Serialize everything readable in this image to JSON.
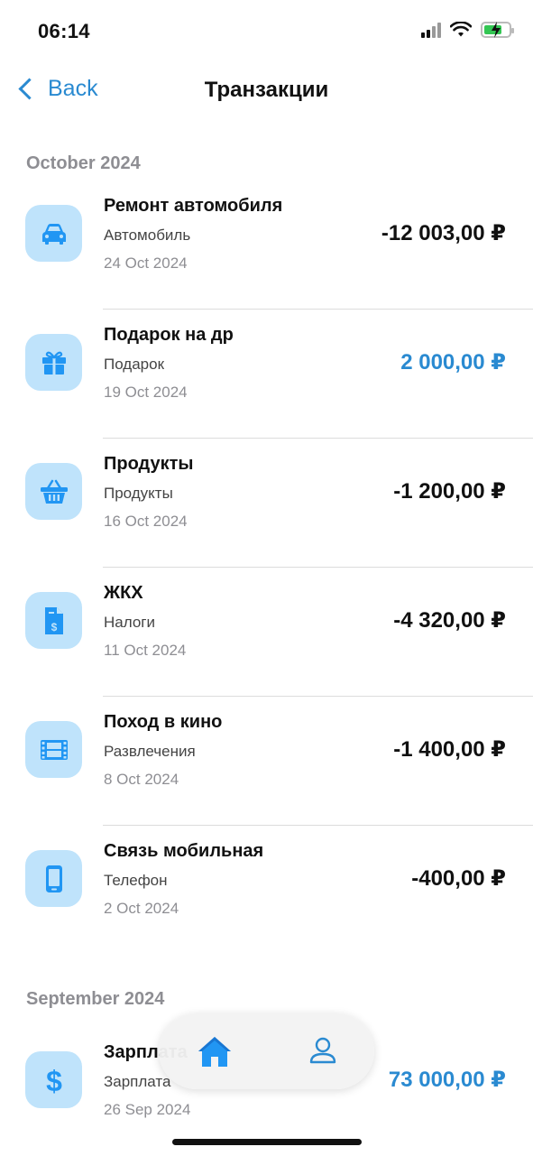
{
  "status": {
    "time": "06:14"
  },
  "nav": {
    "back_label": "Back",
    "title": "Транзакции"
  },
  "sections": [
    {
      "header": "October 2024",
      "items": [
        {
          "title": "Ремонт автомобиля",
          "category": "Автомобиль",
          "date": "24 Oct 2024",
          "amount": "-12 003,00 ₽",
          "icon": "car-icon"
        },
        {
          "title": "Подарок на др",
          "category": "Подарок",
          "date": "19 Oct 2024",
          "amount": "2 000,00 ₽",
          "icon": "gift-icon"
        },
        {
          "title": "Продукты",
          "category": "Продукты",
          "date": "16 Oct 2024",
          "amount": "-1 200,00 ₽",
          "icon": "basket-icon"
        },
        {
          "title": "ЖКХ",
          "category": "Налоги",
          "date": "11 Oct 2024",
          "amount": "-4 320,00 ₽",
          "icon": "bill-icon"
        },
        {
          "title": "Поход в кино",
          "category": "Развлечения",
          "date": "8 Oct 2024",
          "amount": "-1 400,00 ₽",
          "icon": "film-icon"
        },
        {
          "title": "Связь мобильная",
          "category": "Телефон",
          "date": "2 Oct 2024",
          "amount": "-400,00 ₽",
          "icon": "phone-icon"
        }
      ]
    },
    {
      "header": "September 2024",
      "items": [
        {
          "title": "Зарплата",
          "category": "Зарплата",
          "date": "26 Sep 2024",
          "amount": "73 000,00 ₽",
          "icon": "dollar-icon"
        }
      ]
    }
  ],
  "tabs": [
    {
      "icon": "home-icon",
      "active": true
    },
    {
      "icon": "profile-icon",
      "active": false
    }
  ],
  "colors": {
    "accent": "#2a8ad1",
    "icon_bg": "#bfe3fb",
    "icon_fg": "#2196f3",
    "secondary_text": "#8e8e93"
  }
}
